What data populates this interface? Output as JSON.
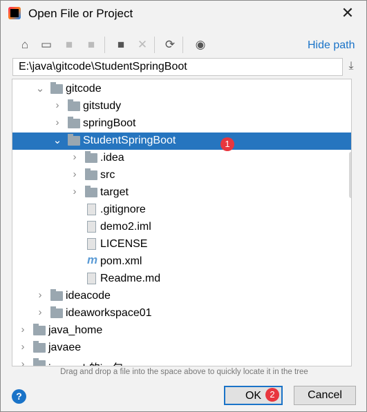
{
  "dialog": {
    "title": "Open File or Project",
    "close_icon": "close-icon"
  },
  "toolbar": {
    "icons": [
      "home-icon",
      "desktop-icon",
      "project-icon",
      "module-icon",
      "new-folder-icon",
      "delete-icon",
      "refresh-icon",
      "show-hidden-icon"
    ],
    "hide_path": "Hide path"
  },
  "path": {
    "value": "E:\\java\\gitcode\\StudentSpringBoot"
  },
  "tree": {
    "items": [
      {
        "label": "gitcode",
        "type": "folder",
        "depth": 2,
        "expanded": true
      },
      {
        "label": "gitstudy",
        "type": "folder",
        "depth": 3,
        "expanded": false
      },
      {
        "label": "springBoot",
        "type": "module-folder",
        "depth": 3,
        "expanded": false
      },
      {
        "label": "StudentSpringBoot",
        "type": "module-folder",
        "depth": 3,
        "expanded": true,
        "selected": true
      },
      {
        "label": ".idea",
        "type": "folder",
        "depth": 4,
        "expanded": false
      },
      {
        "label": "src",
        "type": "folder",
        "depth": 4,
        "expanded": false
      },
      {
        "label": "target",
        "type": "folder",
        "depth": 4,
        "expanded": false
      },
      {
        "label": ".gitignore",
        "type": "file",
        "depth": 4
      },
      {
        "label": "demo2.iml",
        "type": "file",
        "depth": 4
      },
      {
        "label": "LICENSE",
        "type": "file",
        "depth": 4
      },
      {
        "label": "pom.xml",
        "type": "maven",
        "depth": 4
      },
      {
        "label": "Readme.md",
        "type": "markdown",
        "depth": 4
      },
      {
        "label": "ideacode",
        "type": "folder",
        "depth": 2,
        "expanded": false
      },
      {
        "label": "ideaworkspace01",
        "type": "folder",
        "depth": 2,
        "expanded": false
      },
      {
        "label": "java_home",
        "type": "folder",
        "depth": 1,
        "expanded": false
      },
      {
        "label": "javaee",
        "type": "folder",
        "depth": 1,
        "expanded": false
      },
      {
        "label": "javaweb的jar包",
        "type": "folder",
        "depth": 1,
        "expanded": false
      }
    ]
  },
  "annotations": [
    "1",
    "2"
  ],
  "hint": "Drag and drop a file into the space above to quickly locate it in the tree",
  "buttons": {
    "help": "?",
    "ok": "OK",
    "cancel": "Cancel"
  },
  "colors": {
    "accent": "#1a73c8",
    "selection": "#2675bf",
    "badge": "#e8363e"
  }
}
